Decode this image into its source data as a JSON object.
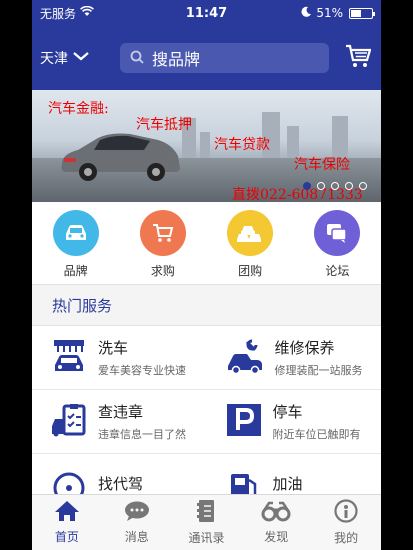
{
  "status_bar": {
    "carrier": "无服务",
    "time": "11:47",
    "battery": "51%",
    "battery_level": 0.51
  },
  "header": {
    "city": "天津",
    "search_placeholder": "搜品牌"
  },
  "banner": {
    "lines": [
      "汽车金融:",
      "汽车抵押",
      "汽车贷款",
      "汽车保险"
    ],
    "phone": "直拨022-60871333",
    "slide_count": 5,
    "active_slide": 1
  },
  "shortcuts": [
    {
      "label": "品牌",
      "icon": "car-icon",
      "color": "#42b8e8"
    },
    {
      "label": "求购",
      "icon": "cart-icon",
      "color": "#f07850"
    },
    {
      "label": "团购",
      "icon": "group-cars-icon",
      "color": "#f4c832"
    },
    {
      "label": "论坛",
      "icon": "chat-icon",
      "color": "#7060d8"
    }
  ],
  "section_title": "热门服务",
  "services": [
    {
      "name": "洗车",
      "desc": "爱车美容专业快速",
      "icon": "car-wash-icon"
    },
    {
      "name": "维修保养",
      "desc": "修理装配一站服务",
      "icon": "repair-icon"
    },
    {
      "name": "查违章",
      "desc": "违章信息一目了然",
      "icon": "violation-icon"
    },
    {
      "name": "停车",
      "desc": "附近车位已触即有",
      "icon": "parking-icon"
    },
    {
      "name": "找代驾",
      "desc": "",
      "icon": "driver-icon"
    },
    {
      "name": "加油",
      "desc": "",
      "icon": "fuel-icon"
    }
  ],
  "tabs": [
    {
      "label": "首页",
      "icon": "home-icon",
      "active": true
    },
    {
      "label": "消息",
      "icon": "message-icon",
      "active": false
    },
    {
      "label": "通讯录",
      "icon": "contacts-icon",
      "active": false
    },
    {
      "label": "发现",
      "icon": "discover-icon",
      "active": false
    },
    {
      "label": "我的",
      "icon": "profile-icon",
      "active": false
    }
  ],
  "colors": {
    "brand": "#2a3a9c",
    "banner_text": "#ee0000"
  }
}
